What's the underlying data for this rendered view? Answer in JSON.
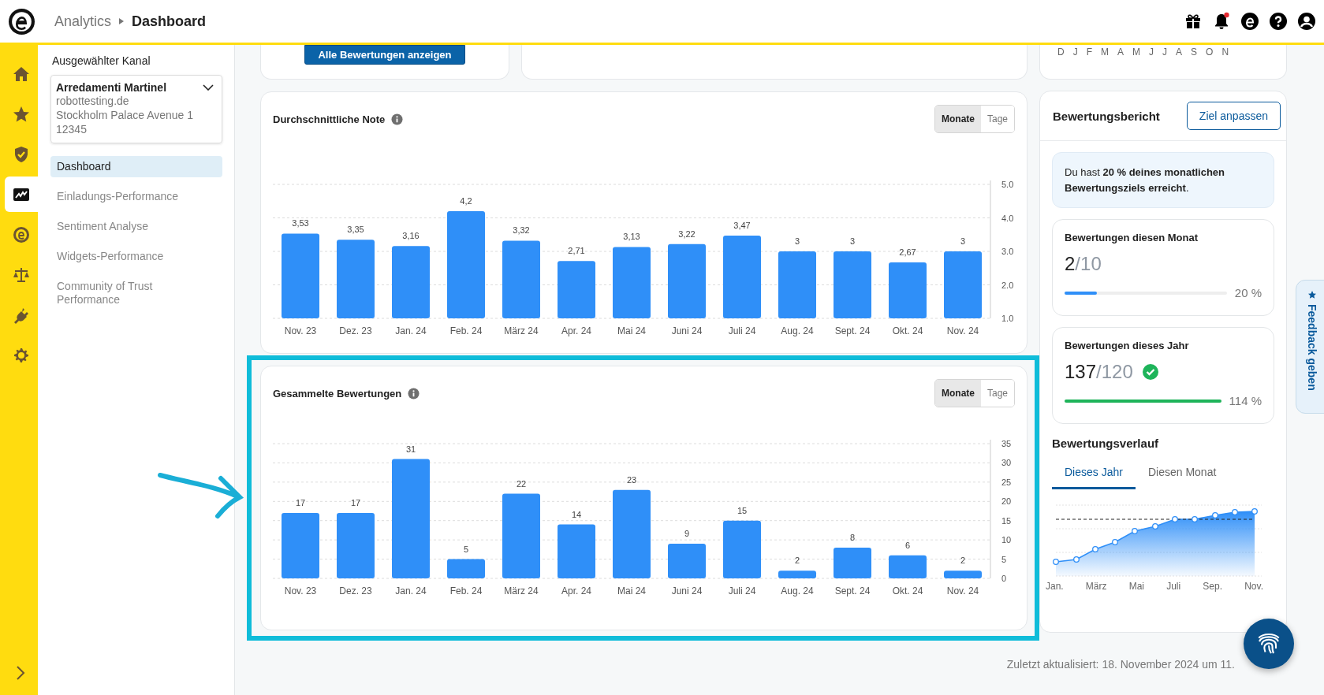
{
  "header": {
    "breadcrumb": "Analytics",
    "title": "Dashboard",
    "notifications_unread": true
  },
  "rail": [
    {
      "selected": false
    },
    {
      "selected": false
    },
    {
      "selected": false
    },
    {
      "selected": true
    },
    {
      "selected": false
    },
    {
      "selected": false
    },
    {
      "selected": false
    },
    {
      "selected": false
    }
  ],
  "sidebar": {
    "channel_label": "Ausgewählter Kanal",
    "channel": {
      "name": "Arredamenti Martinel",
      "lines": [
        "robottesting.de",
        "Stockholm Palace Avenue 1",
        "12345"
      ]
    },
    "items": [
      {
        "label": "Dashboard",
        "selected": true
      },
      {
        "label": "Einladungs-Performance",
        "selected": false
      },
      {
        "label": "Sentiment Analyse",
        "selected": false
      },
      {
        "label": "Widgets-Performance",
        "selected": false
      },
      {
        "label": "Community of Trust Performance",
        "selected": false
      }
    ]
  },
  "top_cards": {
    "button": "Alle Bewertungen anzeigen",
    "months": [
      "D",
      "J",
      "F",
      "M",
      "A",
      "M",
      "J",
      "J",
      "A",
      "S",
      "O",
      "N"
    ]
  },
  "charts": [
    {
      "title": "Durchschnittliche Note",
      "toggle": [
        {
          "label": "Monate",
          "selected": true
        },
        {
          "label": "Tage",
          "selected": false
        }
      ],
      "highlighted": false,
      "chart_data": {
        "type": "bar",
        "categories": [
          "Nov. 23",
          "Dez. 23",
          "Jan. 24",
          "Feb. 24",
          "März 24",
          "Apr. 24",
          "Mai 24",
          "Juni 24",
          "Juli 24",
          "Aug. 24",
          "Sept. 24",
          "Okt. 24",
          "Nov. 24"
        ],
        "values": [
          3.53,
          3.35,
          3.16,
          4.2,
          3.32,
          2.71,
          3.13,
          3.22,
          3.47,
          3,
          3,
          2.67,
          3
        ],
        "value_labels": [
          "3,53",
          "3,35",
          "3,16",
          "4,2",
          "3,32",
          "2,71",
          "3,13",
          "3,22",
          "3,47",
          "3",
          "3",
          "2,67",
          "3"
        ],
        "grid": true,
        "ylim": [
          1,
          5
        ],
        "yticks": [
          {
            "value": 1,
            "label": "1.0"
          },
          {
            "value": 2,
            "label": "2.0"
          },
          {
            "value": 3,
            "label": "3.0"
          },
          {
            "value": 4,
            "label": "4.0"
          },
          {
            "value": 5,
            "label": "5.0"
          }
        ]
      }
    },
    {
      "title": "Gesammelte Bewertungen",
      "toggle": [
        {
          "label": "Monate",
          "selected": true
        },
        {
          "label": "Tage",
          "selected": false
        }
      ],
      "highlighted": true,
      "chart_data": {
        "type": "bar",
        "categories": [
          "Nov. 23",
          "Dez. 23",
          "Jan. 24",
          "Feb. 24",
          "März 24",
          "Apr. 24",
          "Mai 24",
          "Juni 24",
          "Juli 24",
          "Aug. 24",
          "Sept. 24",
          "Okt. 24",
          "Nov. 24"
        ],
        "values": [
          17,
          17,
          31,
          5,
          22,
          14,
          23,
          9,
          15,
          2,
          8,
          6,
          2
        ],
        "value_labels": [
          "17",
          "17",
          "31",
          "5",
          "22",
          "14",
          "23",
          "9",
          "15",
          "2",
          "8",
          "6",
          "2"
        ],
        "grid": true,
        "ylim": [
          0,
          35
        ],
        "yticks": [
          0,
          5,
          10,
          15,
          20,
          25,
          30,
          35
        ]
      }
    }
  ],
  "report": {
    "title": "Bewertungsbericht",
    "button": "Ziel anpassen",
    "info": "Du hast **20 % deines monatlichen Bewertungsziels erreicht**.",
    "stats": [
      {
        "title": "Bewertungen diesen Monat",
        "value": "2",
        "target": "/10",
        "level": 0.2,
        "reading": "20 %",
        "reached": false
      },
      {
        "title": "Bewertungen dieses Jahr",
        "value": "137",
        "target": "/120",
        "level": 1,
        "reading": "114 %",
        "reached": true
      }
    ],
    "history_title": "Bewertungsverlauf",
    "tabs": [
      {
        "label": "Dieses Jahr",
        "selected": true
      },
      {
        "label": "Diesen Monat",
        "selected": false
      }
    ],
    "x_labels": [
      "Jan.",
      "März",
      "Mai",
      "Juli",
      "Sep.",
      "Nov."
    ]
  },
  "footer": "Zuletzt aktualisiert: 18. November 2024 um 11.",
  "feedback": "Feedback geben"
}
